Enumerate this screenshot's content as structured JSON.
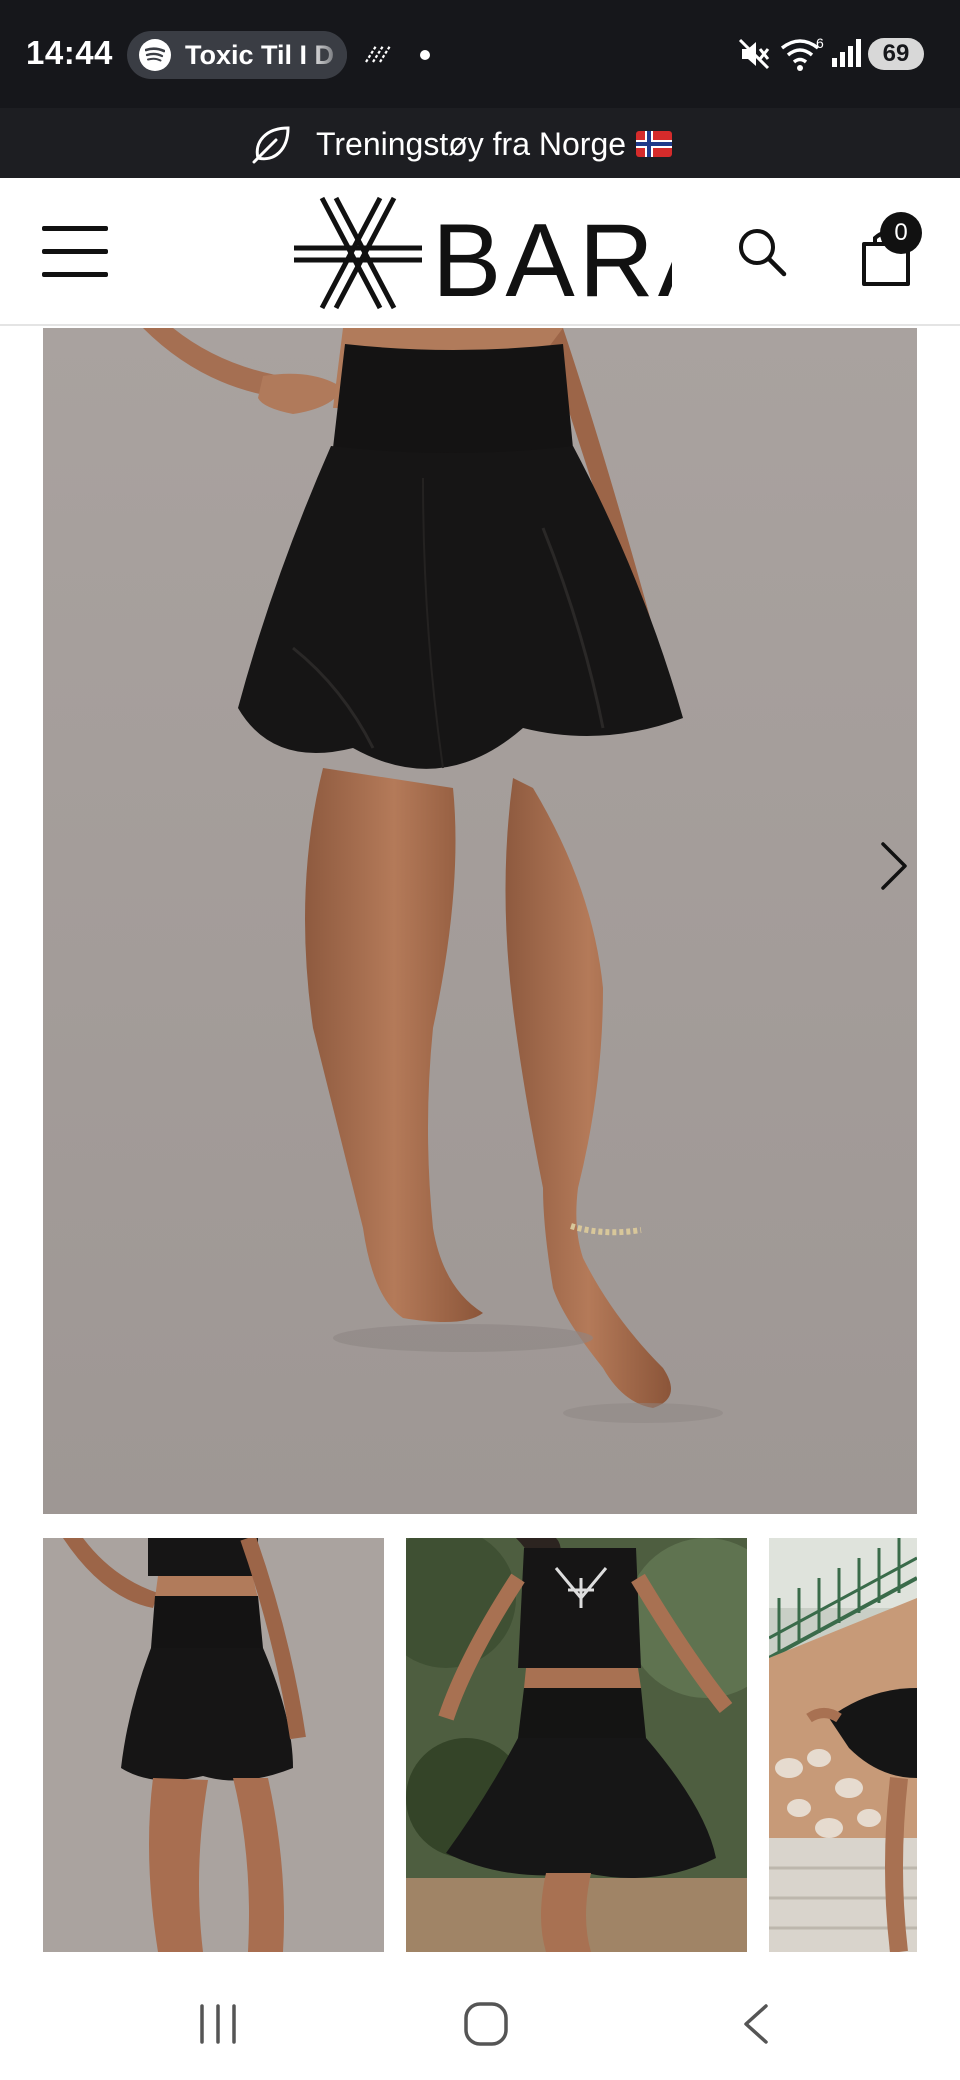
{
  "status_bar": {
    "time": "14:44",
    "media_title": "Toxic Til I D",
    "battery": "69",
    "icons": [
      "spotify-icon",
      "nfc-icon",
      "dot-icon",
      "mute-icon",
      "wifi-icon",
      "signal-icon",
      "battery-icon"
    ],
    "wifi_badge": "6"
  },
  "promo": {
    "text": "Treningstøy fra Norge",
    "icon": "leaf-icon",
    "flag": "norway-flag-icon"
  },
  "header": {
    "logo_text": "BARA",
    "cart_count": "0",
    "icons": [
      "menu-icon",
      "search-icon",
      "cart-icon"
    ]
  },
  "gallery": {
    "main_image": "model-black-flared-skirt-front",
    "thumbnails": [
      "model-black-skirt-studio",
      "model-black-skirt-outdoor-spinning",
      "model-black-skirt-wall"
    ],
    "next_icon": "chevron-right-icon"
  },
  "colors": {
    "status_bg": "#16171b",
    "promo_bg": "#1d1e22",
    "photo_bg": "#aaa39f",
    "text_dark": "#111111"
  },
  "nav": {
    "icons": [
      "recent-apps-icon",
      "home-icon",
      "back-icon"
    ]
  }
}
